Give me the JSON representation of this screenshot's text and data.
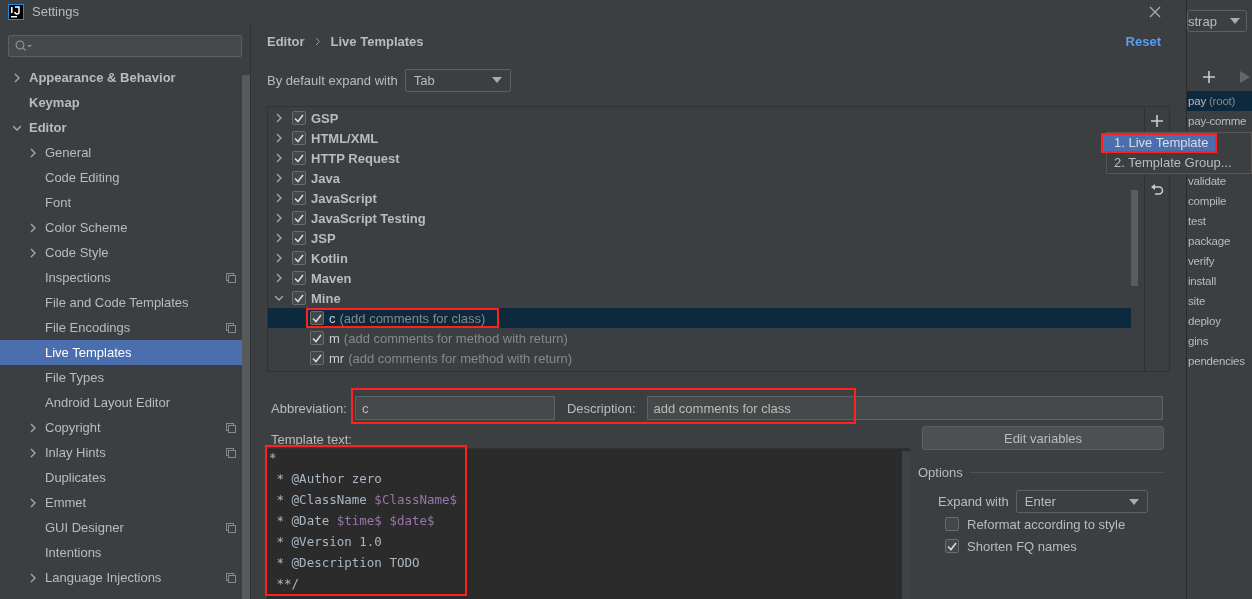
{
  "window": {
    "title": "Settings"
  },
  "sidebar": {
    "items": [
      {
        "label": "Appearance & Behavior",
        "kind": "group",
        "expanded": false,
        "selected": false,
        "scoped": false
      },
      {
        "label": "Keymap",
        "kind": "item",
        "selected": false,
        "scoped": false
      },
      {
        "label": "Editor",
        "kind": "group",
        "expanded": true,
        "selected": false,
        "scoped": false,
        "children": [
          {
            "label": "General",
            "kind": "group",
            "expanded": false,
            "selected": false,
            "scoped": false
          },
          {
            "label": "Code Editing",
            "kind": "item",
            "selected": false,
            "scoped": false
          },
          {
            "label": "Font",
            "kind": "item",
            "selected": false,
            "scoped": false
          },
          {
            "label": "Color Scheme",
            "kind": "group",
            "expanded": false,
            "selected": false,
            "scoped": false
          },
          {
            "label": "Code Style",
            "kind": "group",
            "expanded": false,
            "selected": false,
            "scoped": false
          },
          {
            "label": "Inspections",
            "kind": "item",
            "selected": false,
            "scoped": true
          },
          {
            "label": "File and Code Templates",
            "kind": "item",
            "selected": false,
            "scoped": false
          },
          {
            "label": "File Encodings",
            "kind": "item",
            "selected": false,
            "scoped": true
          },
          {
            "label": "Live Templates",
            "kind": "item",
            "selected": true,
            "scoped": false
          },
          {
            "label": "File Types",
            "kind": "item",
            "selected": false,
            "scoped": false
          },
          {
            "label": "Android Layout Editor",
            "kind": "item",
            "selected": false,
            "scoped": false
          },
          {
            "label": "Copyright",
            "kind": "group",
            "expanded": false,
            "selected": false,
            "scoped": true
          },
          {
            "label": "Inlay Hints",
            "kind": "group",
            "expanded": false,
            "selected": false,
            "scoped": true
          },
          {
            "label": "Duplicates",
            "kind": "item",
            "selected": false,
            "scoped": false
          },
          {
            "label": "Emmet",
            "kind": "group",
            "expanded": false,
            "selected": false,
            "scoped": false
          },
          {
            "label": "GUI Designer",
            "kind": "item",
            "selected": false,
            "scoped": true
          },
          {
            "label": "Intentions",
            "kind": "item",
            "selected": false,
            "scoped": false
          },
          {
            "label": "Language Injections",
            "kind": "group",
            "expanded": false,
            "selected": false,
            "scoped": true
          }
        ]
      }
    ]
  },
  "breadcrumb": [
    "Editor",
    "Live Templates"
  ],
  "reset_link": "Reset",
  "default_expand": {
    "label": "By default expand with",
    "value": "Tab"
  },
  "template_groups": [
    {
      "name": "GSP",
      "checked": true,
      "expanded": false
    },
    {
      "name": "HTML/XML",
      "checked": true,
      "expanded": false
    },
    {
      "name": "HTTP Request",
      "checked": true,
      "expanded": false
    },
    {
      "name": "Java",
      "checked": true,
      "expanded": false
    },
    {
      "name": "JavaScript",
      "checked": true,
      "expanded": false
    },
    {
      "name": "JavaScript Testing",
      "checked": true,
      "expanded": false
    },
    {
      "name": "JSP",
      "checked": true,
      "expanded": false
    },
    {
      "name": "Kotlin",
      "checked": true,
      "expanded": false
    },
    {
      "name": "Maven",
      "checked": true,
      "expanded": false
    },
    {
      "name": "Mine",
      "checked": true,
      "expanded": true,
      "children": [
        {
          "abbreviation": "c",
          "description": "(add comments for class)",
          "checked": true,
          "selected": true,
          "marked": true
        },
        {
          "abbreviation": "m",
          "description": "(add comments for method with return)",
          "checked": true,
          "selected": false,
          "marked": false
        },
        {
          "abbreviation": "mr",
          "description": "(add comments for method with return)",
          "checked": true,
          "selected": false,
          "marked": false
        }
      ]
    }
  ],
  "add_menu": {
    "items": [
      {
        "label": "1. Live Template",
        "selected": true,
        "marked": true
      },
      {
        "label": "2. Template Group...",
        "selected": false,
        "marked": false
      }
    ]
  },
  "abbreviation": {
    "label": "Abbreviation:",
    "value": "c"
  },
  "description": {
    "label": "Description:",
    "value": "add comments for class"
  },
  "fields_marked": true,
  "template_text": {
    "label": "Template text:",
    "marked": true,
    "lines": [
      [
        {
          "kind": "plain",
          "text": "*"
        }
      ],
      [
        {
          "kind": "plain",
          "text": " * @Author zero"
        }
      ],
      [
        {
          "kind": "plain",
          "text": " * @ClassName "
        },
        {
          "kind": "variable",
          "text": "$ClassName$"
        }
      ],
      [
        {
          "kind": "plain",
          "text": " * @Date "
        },
        {
          "kind": "variable",
          "text": "$time$ $date$"
        }
      ],
      [
        {
          "kind": "plain",
          "text": " * @Version 1.0"
        }
      ],
      [
        {
          "kind": "plain",
          "text": " * @Description TODO"
        }
      ],
      [
        {
          "kind": "plain",
          "text": " **/"
        }
      ]
    ]
  },
  "edit_variables_button": "Edit variables",
  "options": {
    "title": "Options",
    "expand_with": {
      "label": "Expand with",
      "value": "Enter"
    },
    "checkboxes": [
      {
        "label": "Reformat according to style",
        "checked": false
      },
      {
        "label": "Shorten FQ names",
        "checked": true
      }
    ]
  },
  "maven": {
    "profile": "strap",
    "items": [
      {
        "name": "pay",
        "note": "(root)",
        "selected": true
      },
      {
        "name": "pay-comme",
        "selected": false
      },
      {
        "name": "validate",
        "selected": false
      },
      {
        "name": "compile",
        "selected": false
      },
      {
        "name": "test",
        "selected": false
      },
      {
        "name": "package",
        "selected": false
      },
      {
        "name": "verify",
        "selected": false
      },
      {
        "name": "install",
        "selected": false
      },
      {
        "name": "site",
        "selected": false
      },
      {
        "name": "deploy",
        "selected": false
      },
      {
        "name": "gins",
        "selected": false
      },
      {
        "name": "pendencies",
        "selected": false
      }
    ]
  }
}
